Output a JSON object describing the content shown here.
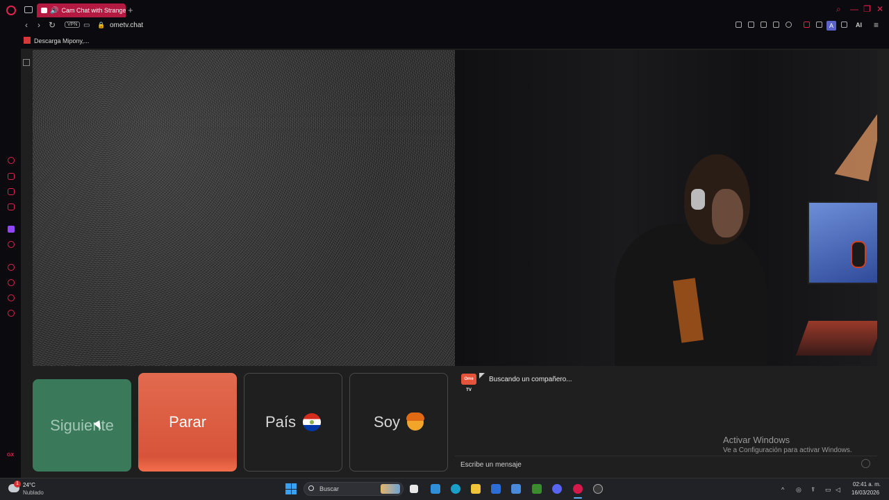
{
  "browser": {
    "tab_title": "Cam Chat with Strange",
    "url": "ometv.chat",
    "vpn_label": "VPN",
    "ai_label": "AI",
    "avatar_letter": "A",
    "bookmark": "Descarga Mipony,..."
  },
  "controls": {
    "next_label": "Siguiente",
    "stop_label": "Parar",
    "country_label": "País",
    "gender_label": "Soy",
    "country_flag": "paraguay-flag",
    "colors": {
      "next": "#3a7a5b",
      "stop": "#e26a4e"
    }
  },
  "chat": {
    "logo_text": "Ome TV",
    "status": "Buscando un compañero...",
    "placeholder": "Escribe un mensaje"
  },
  "watermark": {
    "title": "Activar Windows",
    "subtitle": "Ve a Configuración para activar Windows."
  },
  "taskbar": {
    "weather_temp": "24°C",
    "weather_condition": "Nublado",
    "weather_badge": "1",
    "search_label": "Buscar",
    "time": "02:41 a. m.",
    "date": "16/03/2026"
  }
}
